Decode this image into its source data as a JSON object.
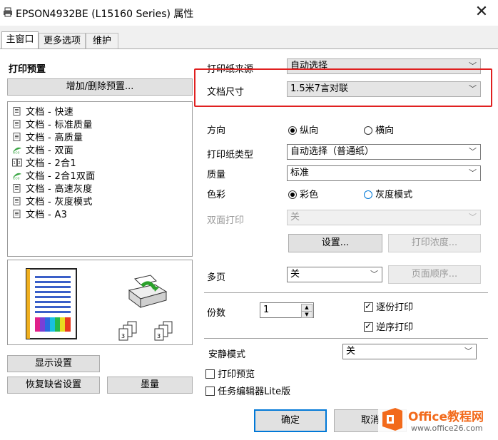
{
  "window": {
    "title": "EPSON4932BE (L15160 Series) 属性",
    "close": "✕"
  },
  "tabs": [
    {
      "label": "主窗口"
    },
    {
      "label": "更多选项"
    },
    {
      "label": "维护"
    }
  ],
  "presets": {
    "heading": "打印预置",
    "add_remove_button": "增加/删除预置...",
    "items": [
      {
        "label": "文档 - 快速",
        "icon": "doc-icon"
      },
      {
        "label": "文档 - 标准质量",
        "icon": "doc-icon"
      },
      {
        "label": "文档 - 高质量",
        "icon": "doc-icon"
      },
      {
        "label": "文档 - 双面",
        "icon": "eco-icon"
      },
      {
        "label": "文档 - 2合1",
        "icon": "two-in-one-icon"
      },
      {
        "label": "文档 - 2合1双面",
        "icon": "eco-icon"
      },
      {
        "label": "文档 - 高速灰度",
        "icon": "doc-icon"
      },
      {
        "label": "文档 - 灰度模式",
        "icon": "doc-icon"
      },
      {
        "label": "文档 - A3",
        "icon": "doc-icon"
      }
    ],
    "show_settings_button": "显示设置",
    "restore_defaults_button": "恢复缺省设置",
    "ink_button": "墨量"
  },
  "settings": {
    "paper_source": {
      "label": "打印纸来源",
      "value": "自动选择"
    },
    "doc_size": {
      "label": "文档尺寸",
      "value": "1.5米7言对联"
    },
    "orientation": {
      "label": "方向",
      "options": [
        "纵向",
        "横向"
      ],
      "selected": "纵向"
    },
    "paper_type": {
      "label": "打印纸类型",
      "value": "自动选择（普通纸）"
    },
    "quality": {
      "label": "质量",
      "value": "标准"
    },
    "color": {
      "label": "色彩",
      "options": [
        "彩色",
        "灰度模式"
      ],
      "selected": "彩色"
    },
    "duplex": {
      "label": "双面打印",
      "value": "关"
    },
    "duplex_settings_button": "设置...",
    "print_density_button": "打印浓度...",
    "multipage": {
      "label": "多页",
      "value": "关"
    },
    "page_order_button": "页面顺序...",
    "copies": {
      "label": "份数",
      "value": "1"
    },
    "collate": {
      "label": "逐份打印",
      "checked": true
    },
    "reverse": {
      "label": "逆序打印",
      "checked": true
    },
    "quiet_mode": {
      "label": "安静模式",
      "value": "关"
    },
    "print_preview": {
      "label": "打印预览",
      "checked": false
    },
    "job_arranger": {
      "label": "任务编辑器Lite版",
      "checked": false
    }
  },
  "footer": {
    "ok_button": "确定",
    "cancel_button": "取消"
  },
  "watermark": {
    "brand": "Office教程网",
    "url": "www.office26.com",
    "accent": "#f26a1b"
  },
  "colors": {
    "highlight": "#e02020",
    "focus": "#0078d7"
  }
}
